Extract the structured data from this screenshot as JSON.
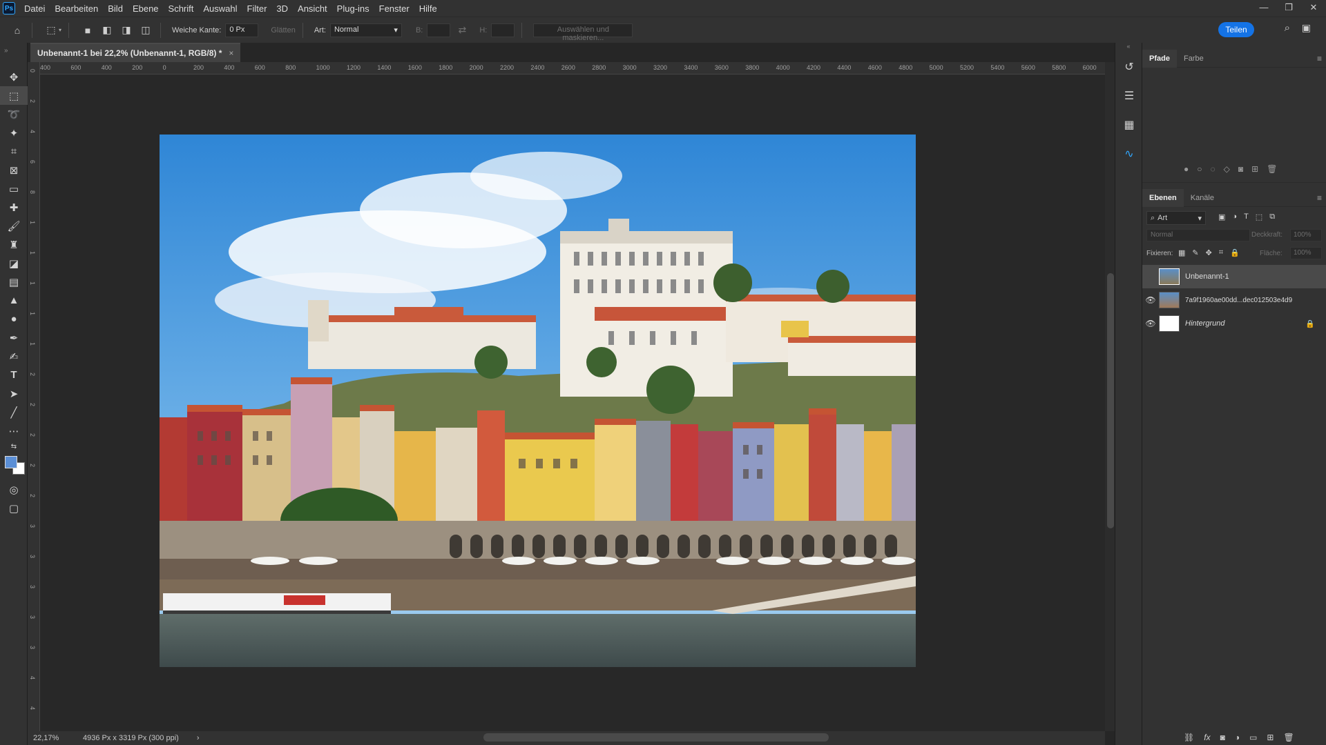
{
  "app": {
    "logo": "Ps"
  },
  "menu": [
    "Datei",
    "Bearbeiten",
    "Bild",
    "Ebene",
    "Schrift",
    "Auswahl",
    "Filter",
    "3D",
    "Ansicht",
    "Plug-ins",
    "Fenster",
    "Hilfe"
  ],
  "window_controls": {
    "minimize": "—",
    "restore": "❐",
    "close": "✕"
  },
  "options": {
    "feather_label": "Weiche Kante:",
    "feather_value": "0 Px",
    "smooth_label": "Glätten",
    "style_label": "Art:",
    "style_value": "Normal",
    "width_label": "B:",
    "height_label": "H:",
    "select_mask": "Auswählen und maskieren...",
    "share": "Teilen"
  },
  "document_tab": {
    "title": "Unbenannt-1 bei 22,2% (Unbenannt-1, RGB/8) *",
    "close": "×"
  },
  "ruler_h_labels": [
    "400",
    "600",
    "400",
    "200",
    "0",
    "200",
    "400",
    "600",
    "800",
    "1000",
    "1200",
    "1400",
    "1600",
    "1800",
    "2000",
    "2200",
    "2400",
    "2600",
    "2800",
    "3000",
    "3200",
    "3400",
    "3600",
    "3800",
    "4000",
    "4200",
    "4400",
    "4600",
    "4800",
    "5000",
    "5200",
    "5400",
    "5600",
    "5800",
    "6000"
  ],
  "ruler_v_labels": [
    "0",
    "2",
    "4",
    "6",
    "8",
    "1",
    "1",
    "1",
    "1",
    "1",
    "2",
    "2",
    "2",
    "2",
    "2",
    "3",
    "3",
    "3",
    "3",
    "3",
    "4",
    "4",
    "4"
  ],
  "status": {
    "zoom": "22,17%",
    "doc_info": "4936 Px x 3319 Px (300 ppi)",
    "arrow": "›"
  },
  "panels": {
    "top_tabs": [
      "Pfade",
      "Farbe"
    ],
    "layers_tabs": [
      "Ebenen",
      "Kanäle"
    ],
    "filter_kind": "Art",
    "blend_mode": "Normal",
    "opacity_label": "Deckkraft:",
    "opacity_value": "100%",
    "lock_label": "Fixieren:",
    "fill_label": "Fläche:",
    "fill_value": "100%"
  },
  "layers": [
    {
      "name": "Unbenannt-1",
      "visible": false,
      "selected": true
    },
    {
      "name": "7a9f1960ae00dd...dec012503e4d9",
      "visible": true,
      "selected": false
    },
    {
      "name": "Hintergrund",
      "visible": true,
      "selected": false,
      "locked": true
    }
  ],
  "colors": {
    "accent": "#1473e6",
    "foreground": "#5b8fd6",
    "background": "#ffffff"
  }
}
